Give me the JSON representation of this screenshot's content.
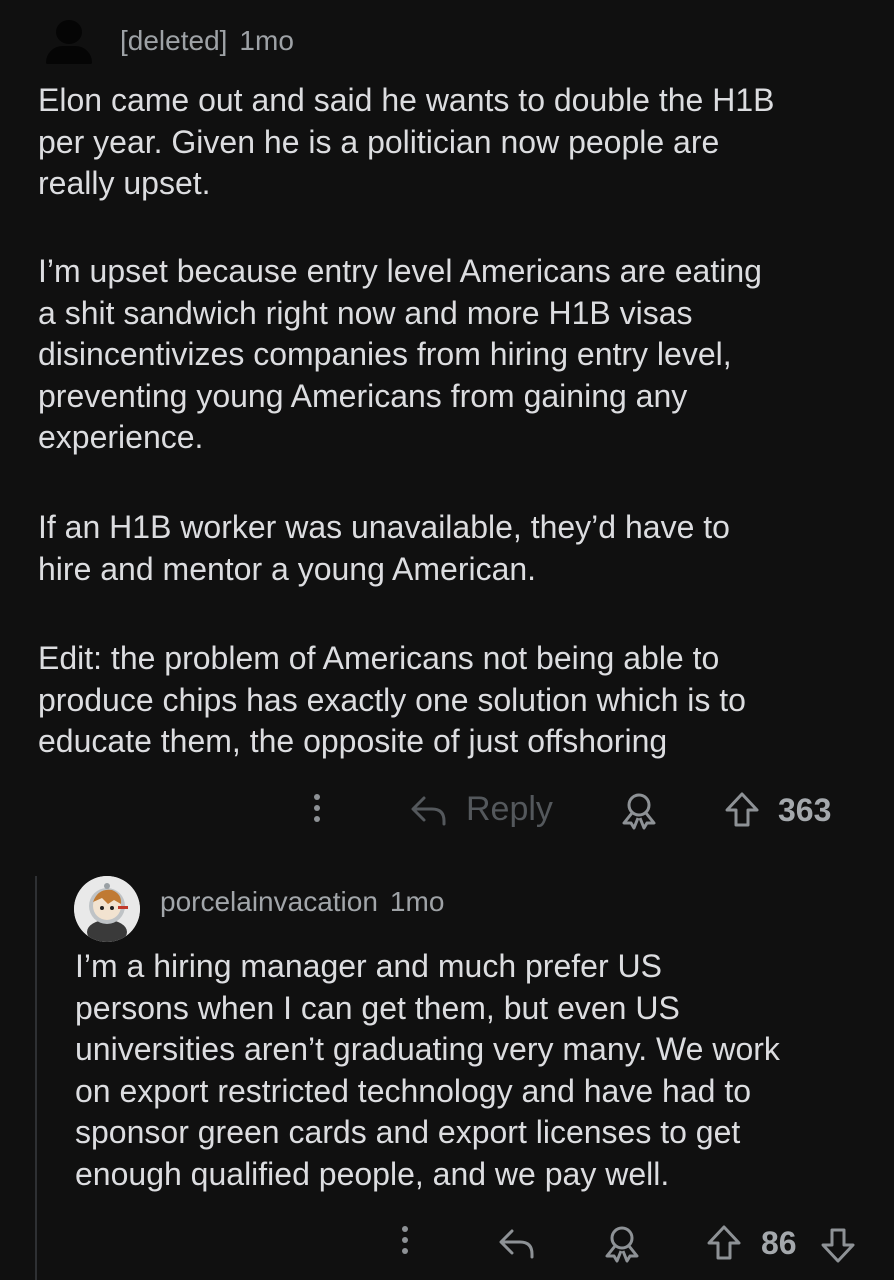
{
  "comment1": {
    "author": "[deleted]",
    "time": "1mo",
    "paragraphs": [
      [
        "Elon came out and said he wants to double the H1B",
        "per year. Given he is a politician now people are",
        "really upset."
      ],
      [
        "I’m upset because entry level Americans are eating",
        "a shit sandwich right now and more H1B visas",
        "disincentivizes companies from hiring entry level,",
        "preventing young Americans from gaining any",
        "experience."
      ],
      [
        "If an H1B worker was unavailable, they’d have to",
        "hire and mentor a young American."
      ],
      [
        "Edit: the problem of Americans not being able to",
        "produce chips has exactly one solution which is to",
        "educate them, the opposite of just offshoring"
      ]
    ],
    "reply_label": "Reply",
    "score": "363",
    "icons": {
      "more": "more-vertical-icon",
      "reply": "reply-arrow-icon",
      "award": "award-icon",
      "upvote": "upvote-arrow-icon"
    }
  },
  "comment2": {
    "author": "porcelainvacation",
    "time": "1mo",
    "lines": [
      "I’m a hiring manager and much prefer US",
      "persons when I can get them, but even US",
      "universities aren’t graduating very many. We work",
      "on export restricted technology and have had to",
      "sponsor green cards and export licenses to get",
      "enough qualified people, and we pay well."
    ],
    "score": "86",
    "icons": {
      "more": "more-vertical-icon",
      "reply": "reply-arrow-icon",
      "award": "award-icon",
      "upvote": "upvote-arrow-icon",
      "downvote": "downvote-arrow-icon"
    }
  }
}
